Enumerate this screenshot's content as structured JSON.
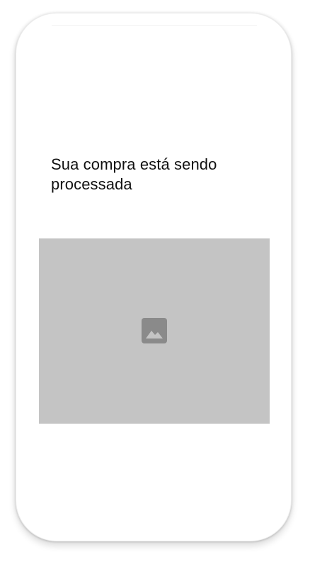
{
  "screen": {
    "title": "Sua compra está sendo processada"
  },
  "media": {
    "icon": "image-placeholder-icon",
    "placeholder_color": "#c4c4c4",
    "icon_color": "#8a8a8a"
  },
  "colors": {
    "title_text": "#111111",
    "background": "#ffffff"
  }
}
